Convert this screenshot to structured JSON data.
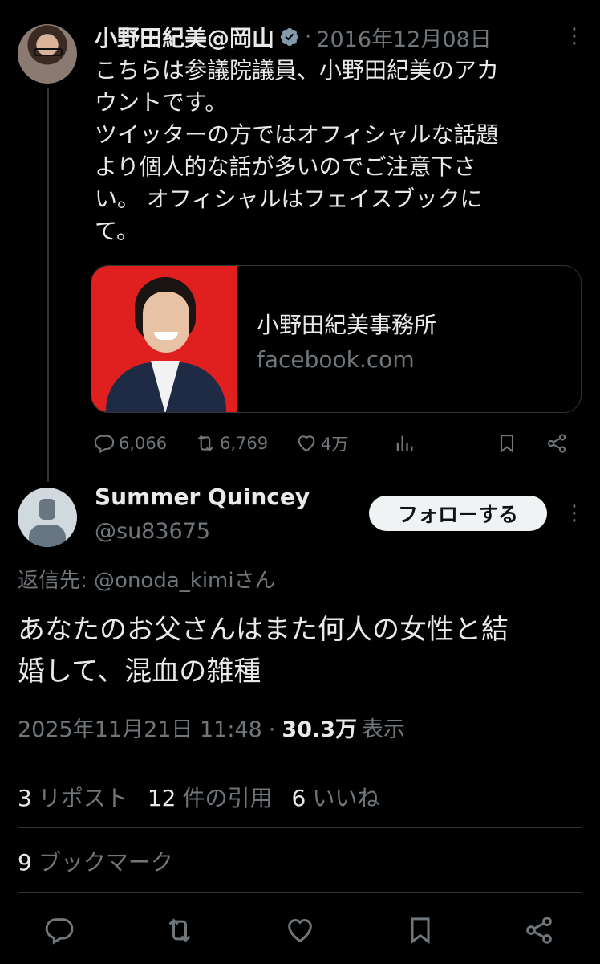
{
  "parent_tweet": {
    "author_name": "小野田紀美@岡山",
    "separator": "·",
    "date": "2016年12月08日",
    "more_symbol": "⋮",
    "text_lines": [
      "こちらは参議院議員、小野田紀美のアカ",
      "ウントです。",
      "ツイッターの方ではオフィシャルな話題",
      "より個人的な話が多いのでご注意下さ",
      "い。 オフィシャルはフェイスブックに",
      "て。"
    ],
    "link_card": {
      "title": "小野田紀美事務所",
      "domain": "facebook.com"
    },
    "actions": {
      "replies": "6,066",
      "reposts": "6,769",
      "likes": "4万"
    },
    "icons": [
      "reply-icon",
      "repost-icon",
      "like-icon",
      "views-icon",
      "bookmark-icon",
      "share-icon"
    ],
    "colors": {
      "verified": "#829aab",
      "muted": "#71767b"
    }
  },
  "reply_tweet": {
    "author_name": "Summer Quincey",
    "handle": "@su83675",
    "follow_label": "フォローする",
    "more_symbol": "⋮",
    "reply_to_prefix": "返信先: ",
    "reply_to_mention": "@onoda_kimi",
    "reply_to_suffix": "さん",
    "text_lines": [
      "あなたのお父さんはまた何人の女性と結",
      "婚して、混血の雑種"
    ],
    "timestamp": "2025年11月21日 11:48",
    "separator": "·",
    "views_count": "30.3万",
    "views_label": "表示",
    "stats": {
      "reposts_count": "3",
      "reposts_label": "リポスト",
      "quotes_count": "12",
      "quotes_label": "件の引用",
      "likes_count": "6",
      "likes_label": "いいね",
      "bookmarks_count": "9",
      "bookmarks_label": "ブックマーク"
    }
  },
  "bottom_bar_icons": [
    "reply-icon",
    "repost-icon",
    "like-icon",
    "bookmark-icon",
    "share-icon"
  ],
  "colors": {
    "background": "#000000",
    "text": "#e7e9ea",
    "muted": "#71767b",
    "divider": "#2f3336",
    "follow_bg": "#eff3f4"
  }
}
